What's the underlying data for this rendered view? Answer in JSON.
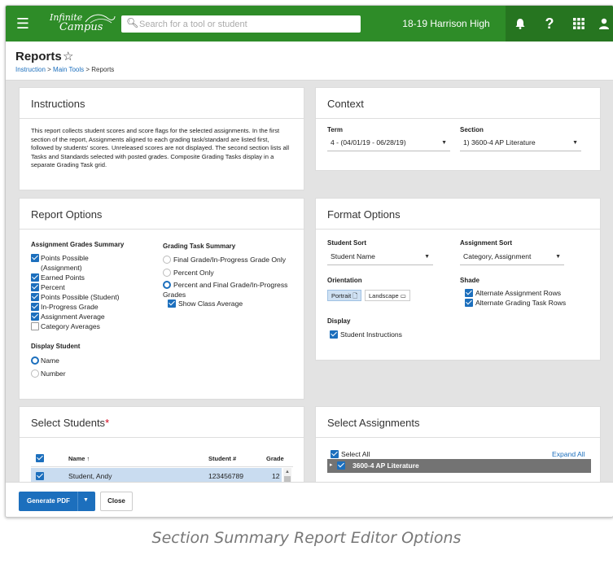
{
  "topbar": {
    "logo_line1": "Infinite",
    "logo_line2": "Campus",
    "search_placeholder": "Search for a tool or student",
    "school": "18-19 Harrison High"
  },
  "header": {
    "title": "Reports",
    "breadcrumb": [
      "Instruction",
      "Main Tools",
      "Reports"
    ],
    "breadcrumb_sep": ">"
  },
  "instructions": {
    "title": "Instructions",
    "text": "This report collects student scores and score flags for the selected assignments. In the first section of the report, Assignments aligned to each grading task/standard are listed first, followed by students' scores. Unreleased scores are not displayed. The second section lists all Tasks and Standards selected with posted grades. Composite Grading Tasks display in a separate Grading Task grid."
  },
  "context": {
    "title": "Context",
    "term_label": "Term",
    "term_value": "4 - (04/01/19 - 06/28/19)",
    "section_label": "Section",
    "section_value": "1) 3600-4 AP Literature"
  },
  "report_options": {
    "title": "Report Options",
    "ags_label": "Assignment Grades Summary",
    "ags_items": [
      {
        "label": "Points Possible",
        "checked": true
      },
      {
        "label": "(Assignment)"
      },
      {
        "label": "Earned Points",
        "checked": true
      },
      {
        "label": "Percent",
        "checked": true
      },
      {
        "label": "Points Possible (Student)",
        "checked": true
      },
      {
        "label": "In-Progress Grade",
        "checked": true
      },
      {
        "label": "Assignment Average",
        "checked": true
      },
      {
        "label": "Category Averages",
        "checked": false
      }
    ],
    "gts_label": "Grading Task Summary",
    "gts_items": [
      {
        "label": "Final Grade/In-Progress Grade Only",
        "selected": false
      },
      {
        "label": "Percent Only",
        "selected": false
      },
      {
        "label": "Percent and Final Grade/In-Progress",
        "selected": true
      },
      {
        "label": "Grades"
      }
    ],
    "show_class_average": "Show Class Average",
    "display_student_label": "Display Student",
    "display_student_options": [
      {
        "label": "Name",
        "selected": true
      },
      {
        "label": "Number",
        "selected": false
      }
    ]
  },
  "format_options": {
    "title": "Format Options",
    "student_sort_label": "Student Sort",
    "student_sort_value": "Student Name",
    "assignment_sort_label": "Assignment Sort",
    "assignment_sort_value": "Category, Assignment",
    "orientation_label": "Orientation",
    "orientation_portrait": "Portrait",
    "orientation_landscape": "Landscape",
    "shade_label": "Shade",
    "shade_items": [
      "Alternate Assignment Rows",
      "Alternate Grading Task Rows"
    ],
    "display_label": "Display",
    "display_item": "Student Instructions"
  },
  "select_students": {
    "title": "Select Students",
    "required_mark": "*",
    "columns": [
      "Name",
      "Student #",
      "Grade"
    ],
    "sort_arrow": "↑",
    "rows": [
      {
        "name": "Student, Andy",
        "number": "123456789",
        "grade": "12"
      }
    ]
  },
  "select_assignments": {
    "title": "Select Assignments",
    "select_all": "Select All",
    "expand_all": "Expand All",
    "tree_item": "3600-4 AP Literature"
  },
  "bottom": {
    "generate_label": "Generate PDF",
    "close_label": "Close"
  },
  "caption": "Section Summary Report Editor Options",
  "colors": {
    "topbar": "#2e8c28",
    "accent": "#1c6fbd",
    "selected_row": "#c9dcf0"
  },
  "icons": [
    "menu-icon",
    "search-icon",
    "bell-icon",
    "help-icon",
    "apps-grid-icon",
    "user-icon",
    "star-icon",
    "chevron-down-icon",
    "page-icon",
    "checkbox-icon",
    "radio-icon",
    "caret-right-icon"
  ]
}
